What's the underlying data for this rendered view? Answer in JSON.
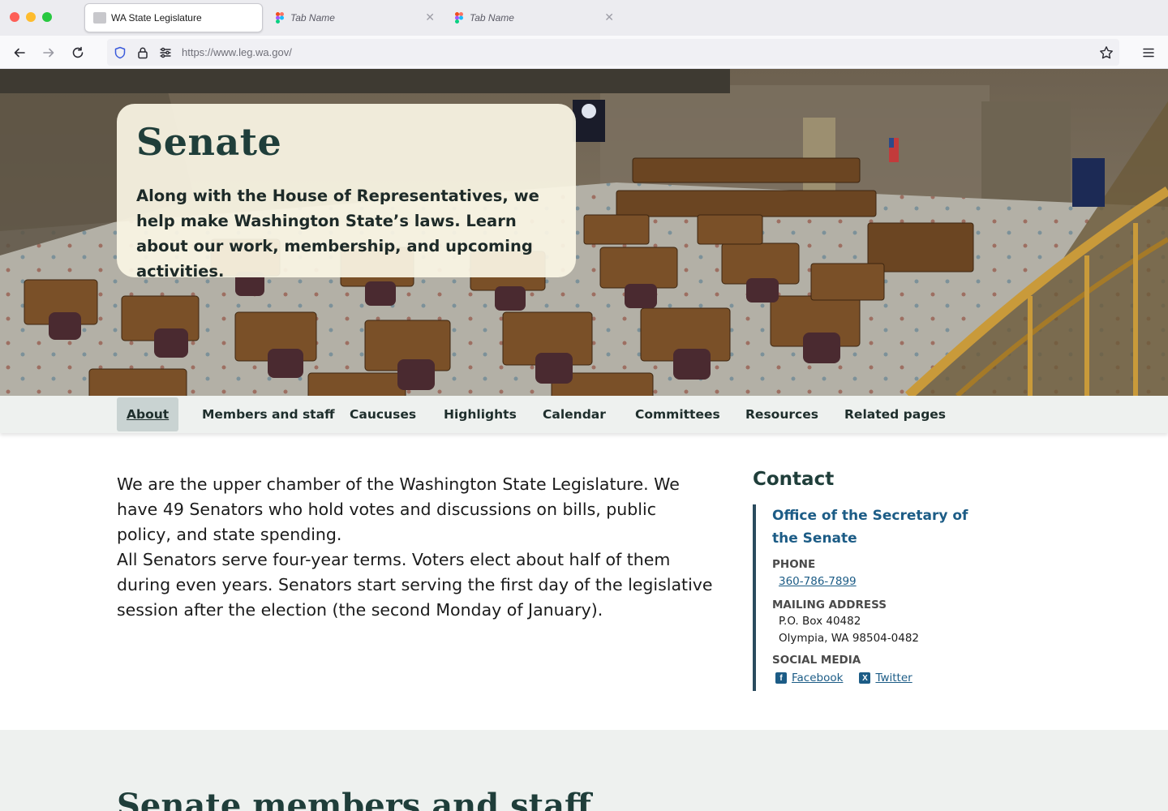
{
  "browser": {
    "tabs": [
      {
        "label": "WA State Legislature",
        "active": true
      },
      {
        "label": "Tab Name",
        "active": false
      },
      {
        "label": "Tab Name",
        "active": false
      }
    ],
    "url": "https://www.leg.wa.gov/"
  },
  "hero": {
    "title": "Senate",
    "description": "Along with the House of Representatives, we help make Washington State’s laws. Learn about our work, membership, and upcoming activities."
  },
  "subnav": {
    "items": [
      "About",
      "Members and staff",
      "Caucuses",
      "Highlights",
      "Calendar",
      "Committees",
      "Resources",
      "Related pages"
    ],
    "active": "About"
  },
  "intro": {
    "p1": "We are the upper chamber of the Washington State Legislature. We have 49 Senators who hold votes and discussions on bills, public policy, and state spending.",
    "p2": "All Senators serve four-year terms. Voters elect about half of them during even years. Senators start serving the first day of the legislative session after the election (the second Monday of January)."
  },
  "contact": {
    "title": "Contact",
    "office": "Office of the Secretary of the Senate",
    "phone_label": "PHONE",
    "phone": "360-786-7899",
    "mailing_label": "MAILING ADDRESS",
    "address_line1": "P.O. Box 40482",
    "address_line2": "Olympia, WA 98504-0482",
    "social_label": "SOCIAL MEDIA",
    "facebook": "Facebook",
    "twitter": "Twitter"
  },
  "members": {
    "title": "Senate members and staff"
  },
  "colors": {
    "accent_dark_green": "#1f3e3a",
    "link_blue": "#1c5c86",
    "subnav_bg": "#eef1ef",
    "hero_card_bg": "#faf5e4"
  }
}
